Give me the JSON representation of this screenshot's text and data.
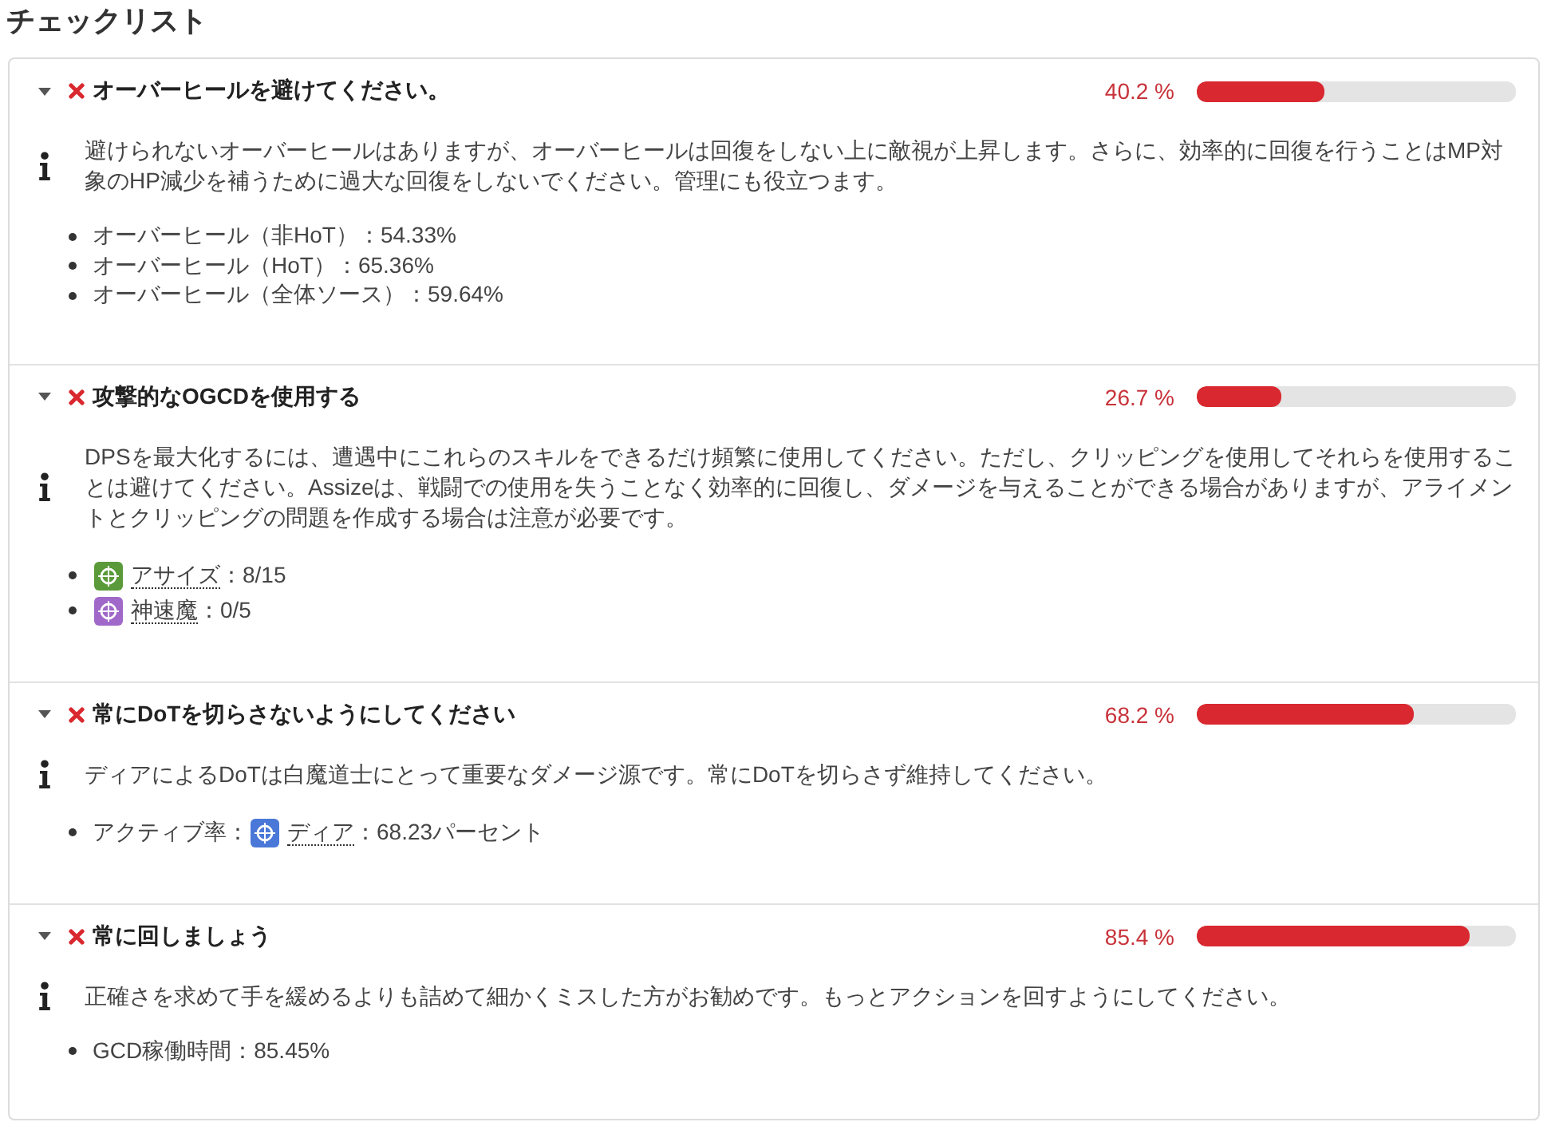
{
  "heading": "チェックリスト",
  "rules": [
    {
      "name": "オーバーヒールを避けてください。",
      "expanded": true,
      "passed": false,
      "percent": "40.2 %",
      "level": 0.402,
      "description": "避けられないオーバーヒールはありますが、オーバーヒールは回復をしない上に敵視が上昇します。さらに、効率的に回復を行うことはMP対象のHP減少を補うために過大な回復をしないでください。管理にも役立つます。",
      "requirements": [
        {
          "parts": [
            {
              "kind": "text",
              "text": "オーバーヒール（非HoT）：54.33%"
            }
          ]
        },
        {
          "parts": [
            {
              "kind": "text",
              "text": "オーバーヒール（HoT）：65.36%"
            }
          ]
        },
        {
          "parts": [
            {
              "kind": "text",
              "text": "オーバーヒール（全体ソース）：59.64%"
            }
          ]
        }
      ]
    },
    {
      "name": "攻撃的なOGCDを使用する",
      "expanded": true,
      "passed": false,
      "percent": "26.7 %",
      "level": 0.267,
      "description": "DPSを最大化するには、遭遇中にこれらのスキルをできるだけ頻繁に使用してください。ただし、クリッピングを使用してそれらを使用することは避けてください。Assizeは、戦闘での使用を失うことなく効率的に回復し、ダメージを与えることができる場合がありますが、アライメントとクリッピングの問題を作成する場合は注意が必要です。",
      "requirements": [
        {
          "parts": [
            {
              "kind": "link",
              "text": "アサイズ",
              "color": "#5a9a3a"
            },
            {
              "kind": "text",
              "text": "：8/15"
            }
          ]
        },
        {
          "parts": [
            {
              "kind": "link",
              "text": "神速魔",
              "color": "#a068c8"
            },
            {
              "kind": "text",
              "text": "：0/5"
            }
          ]
        }
      ]
    },
    {
      "name": "常にDoTを切らさないようにしてください",
      "expanded": true,
      "passed": false,
      "percent": "68.2 %",
      "level": 0.682,
      "description": "ディアによるDoTは白魔道士にとって重要なダメージ源です。常にDoTを切らさず維持してください。",
      "requirements": [
        {
          "parts": [
            {
              "kind": "text",
              "text": "アクティブ率："
            },
            {
              "kind": "link",
              "text": "ディア",
              "color": "#4a78d8"
            },
            {
              "kind": "text",
              "text": "：68.23パーセント"
            }
          ]
        }
      ]
    },
    {
      "name": "常に回しましょう",
      "expanded": true,
      "passed": false,
      "percent": "85.4 %",
      "level": 0.854,
      "description": "正確さを求めて手を緩めるよりも詰めて細かくミスした方がお勧めです。もっとアクションを回すようにしてください。",
      "requirements": [
        {
          "parts": [
            {
              "kind": "text",
              "text": "GCD稼働時間：85.45%"
            }
          ]
        }
      ]
    }
  ]
}
